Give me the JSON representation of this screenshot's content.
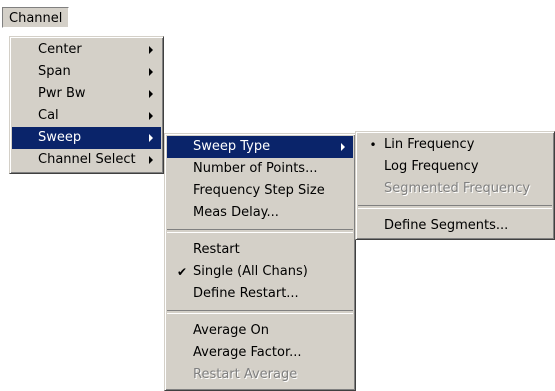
{
  "menubar": {
    "channel_label": "Channel"
  },
  "channel_menu": {
    "items": [
      {
        "label": "Center"
      },
      {
        "label": "Span"
      },
      {
        "label": "Pwr Bw"
      },
      {
        "label": "Cal"
      },
      {
        "label": "Sweep"
      },
      {
        "label": "Channel Select"
      }
    ]
  },
  "sweep_menu": {
    "items": [
      {
        "label": "Sweep Type"
      },
      {
        "label": "Number of Points..."
      },
      {
        "label": "Frequency Step Size"
      },
      {
        "label": "Meas Delay..."
      },
      {
        "label": "Restart"
      },
      {
        "label": "Single (All Chans)"
      },
      {
        "label": "Define Restart..."
      },
      {
        "label": "Average On"
      },
      {
        "label": "Average Factor..."
      },
      {
        "label": "Restart Average"
      }
    ]
  },
  "sweep_type_menu": {
    "items": [
      {
        "label": "Lin Frequency"
      },
      {
        "label": "Log Frequency"
      },
      {
        "label": "Segmented Frequency"
      },
      {
        "label": "Define Segments..."
      }
    ]
  },
  "icons": {
    "bullet": "•",
    "checkmark": "✔"
  },
  "colors": {
    "menu_bg": "#d4d0c8",
    "highlight_bg": "#0a246a",
    "disabled_text": "#808080"
  }
}
